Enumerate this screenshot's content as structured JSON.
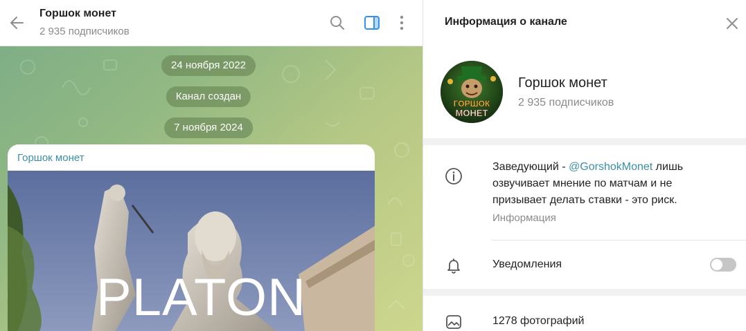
{
  "chat": {
    "title": "Горшок монет",
    "subtitle": "2 935 подписчиков",
    "dates": [
      "24 ноября 2022",
      "Канал создан",
      "7 ноября 2024"
    ],
    "message": {
      "author": "Горшок монет",
      "photo_text": "PLATON"
    }
  },
  "info_panel": {
    "title": "Информация о канале",
    "channel_name": "Горшок монет",
    "subscribers": "2 935 подписчиков",
    "avatar_text_line1": "ГОРШОК",
    "avatar_text_line2": "МОНЕТ",
    "about_prefix": "Заведующий - ",
    "about_mention": "@GorshokMonet",
    "about_suffix": " лишь озвучивает мнение по матчам и не призывает делать ставки - это риск.",
    "about_caption": "Информация",
    "notifications_label": "Уведомления",
    "notifications_on": false,
    "photos_label": "1278 фотографий"
  },
  "colors": {
    "accent": "#3a8fa8",
    "panel_icon": "#3390ec",
    "date_pill": "#6e8c5a"
  },
  "icons": [
    "arrow-left-icon",
    "search-icon",
    "side-panel-icon",
    "more-vertical-icon",
    "close-icon",
    "info-icon",
    "bell-icon",
    "photo-icon"
  ]
}
